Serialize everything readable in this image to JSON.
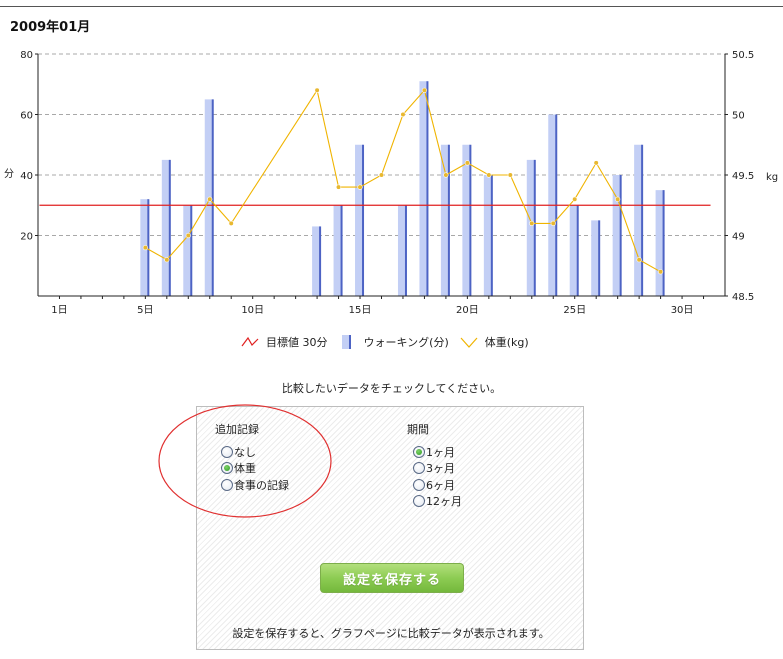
{
  "page": {
    "title": "2009年01月"
  },
  "chart_data": {
    "type": "bar+line",
    "x_axis": {
      "days": [
        1,
        2,
        3,
        4,
        5,
        6,
        7,
        8,
        9,
        10,
        11,
        12,
        13,
        14,
        15,
        16,
        17,
        18,
        19,
        20,
        21,
        22,
        23,
        24,
        25,
        26,
        27,
        28,
        29,
        30,
        31
      ],
      "tick_labels": [
        {
          "day": 1,
          "label": "1日"
        },
        {
          "day": 5,
          "label": "5日"
        },
        {
          "day": 10,
          "label": "10日"
        },
        {
          "day": 15,
          "label": "15日"
        },
        {
          "day": 20,
          "label": "20日"
        },
        {
          "day": 25,
          "label": "25日"
        },
        {
          "day": 30,
          "label": "30日"
        }
      ]
    },
    "y_left": {
      "label": "分",
      "range": [
        0,
        80
      ],
      "ticks": [
        20,
        40,
        60,
        80
      ]
    },
    "y_right": {
      "label": "kg",
      "range": [
        48.5,
        50.5
      ],
      "ticks": [
        48.5,
        49,
        49.5,
        50,
        50.5
      ]
    },
    "grid": true,
    "target": {
      "value": 30,
      "from_day": 1,
      "to_day": 31
    },
    "walking": [
      {
        "day": 5,
        "value": 32
      },
      {
        "day": 6,
        "value": 45
      },
      {
        "day": 7,
        "value": 30
      },
      {
        "day": 8,
        "value": 65
      },
      {
        "day": 13,
        "value": 23
      },
      {
        "day": 14,
        "value": 30
      },
      {
        "day": 15,
        "value": 50
      },
      {
        "day": 17,
        "value": 30
      },
      {
        "day": 18,
        "value": 71
      },
      {
        "day": 19,
        "value": 50
      },
      {
        "day": 20,
        "value": 50
      },
      {
        "day": 21,
        "value": 40
      },
      {
        "day": 23,
        "value": 45
      },
      {
        "day": 24,
        "value": 60
      },
      {
        "day": 25,
        "value": 30
      },
      {
        "day": 26,
        "value": 25
      },
      {
        "day": 27,
        "value": 40
      },
      {
        "day": 28,
        "value": 50
      },
      {
        "day": 29,
        "value": 35
      }
    ],
    "weight": [
      {
        "day": 5,
        "value": 48.9
      },
      {
        "day": 6,
        "value": 48.8
      },
      {
        "day": 7,
        "value": 49.0
      },
      {
        "day": 8,
        "value": 49.3
      },
      {
        "day": 9,
        "value": 49.1
      },
      {
        "day": 13,
        "value": 50.2
      },
      {
        "day": 14,
        "value": 49.4
      },
      {
        "day": 15,
        "value": 49.4
      },
      {
        "day": 16,
        "value": 49.5
      },
      {
        "day": 17,
        "value": 50.0
      },
      {
        "day": 18,
        "value": 50.2
      },
      {
        "day": 19,
        "value": 49.5
      },
      {
        "day": 20,
        "value": 49.6
      },
      {
        "day": 21,
        "value": 49.5
      },
      {
        "day": 22,
        "value": 49.5
      },
      {
        "day": 23,
        "value": 49.1
      },
      {
        "day": 24,
        "value": 49.1
      },
      {
        "day": 25,
        "value": 49.3
      },
      {
        "day": 26,
        "value": 49.6
      },
      {
        "day": 27,
        "value": 49.3
      },
      {
        "day": 28,
        "value": 48.8
      },
      {
        "day": 29,
        "value": 48.7
      }
    ],
    "colors": {
      "target_line": "#e02020",
      "bar_fill": "#c3cff5",
      "bar_edge": "#4d63c4",
      "weight_line": "#f0b400",
      "weight_marker": "#e8b830",
      "grid": "#a8a8a8"
    }
  },
  "legend": {
    "target": "目標値 30分",
    "walking": "ウォーキング(分)",
    "weight": "体重(kg)"
  },
  "instruction": "比較したいデータをチェックしてください。",
  "settings": {
    "extra_group": {
      "title": "追加記録",
      "options": [
        {
          "label": "なし",
          "checked": false
        },
        {
          "label": "体重",
          "checked": true
        },
        {
          "label": "食事の記録",
          "checked": false
        }
      ]
    },
    "period_group": {
      "title": "期間",
      "options": [
        {
          "label": "1ヶ月",
          "checked": true
        },
        {
          "label": "3ヶ月",
          "checked": false
        },
        {
          "label": "6ヶ月",
          "checked": false
        },
        {
          "label": "12ヶ月",
          "checked": false
        }
      ]
    },
    "save_label": "設定を保存する",
    "footnote": "設定を保存すると、グラフページに比較データが表示されます。",
    "annotation_color": "#e03030"
  }
}
